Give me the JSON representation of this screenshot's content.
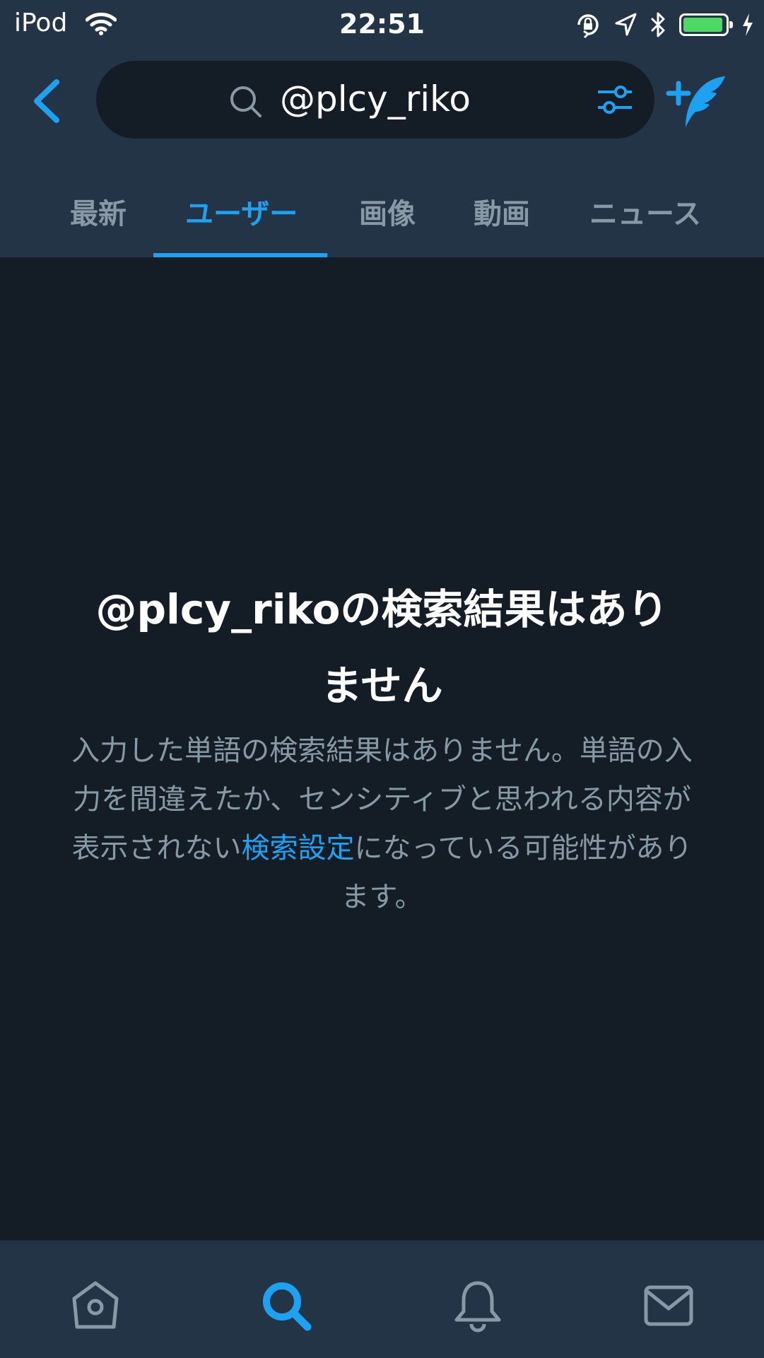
{
  "status_bar": {
    "carrier": "iPod",
    "time": "22:51",
    "battery_level": 0.95,
    "battery_color": "#4cd964"
  },
  "search": {
    "query": "@plcy_riko",
    "icon": "search-icon",
    "filter_icon": "sliders-icon"
  },
  "nav": {
    "back_icon": "chevron-left-icon",
    "compose_icon": "compose-tweet-icon"
  },
  "tabs": [
    {
      "label": "最新",
      "active": false
    },
    {
      "label": "ユーザー",
      "active": true
    },
    {
      "label": "画像",
      "active": false
    },
    {
      "label": "動画",
      "active": false
    },
    {
      "label": "ニュース",
      "active": false
    }
  ],
  "empty_state": {
    "title_line1": "@plcy_rikoの検索結果はあり",
    "title_line2": "ません",
    "desc_before_link": "入力した単語の検索結果はありません。単語の入力を間違えたか、センシティブと思われる内容が表示されない",
    "link": "検索設定",
    "desc_after_link": "になっている可能性があります。"
  },
  "bottom_nav": [
    {
      "icon": "home-icon",
      "active": false
    },
    {
      "icon": "search-icon",
      "active": true
    },
    {
      "icon": "bell-icon",
      "active": false
    },
    {
      "icon": "mail-icon",
      "active": false
    }
  ],
  "colors": {
    "accent": "#1da1f2",
    "background": "#141d26",
    "header": "#243447",
    "muted_text": "#8899a6"
  }
}
